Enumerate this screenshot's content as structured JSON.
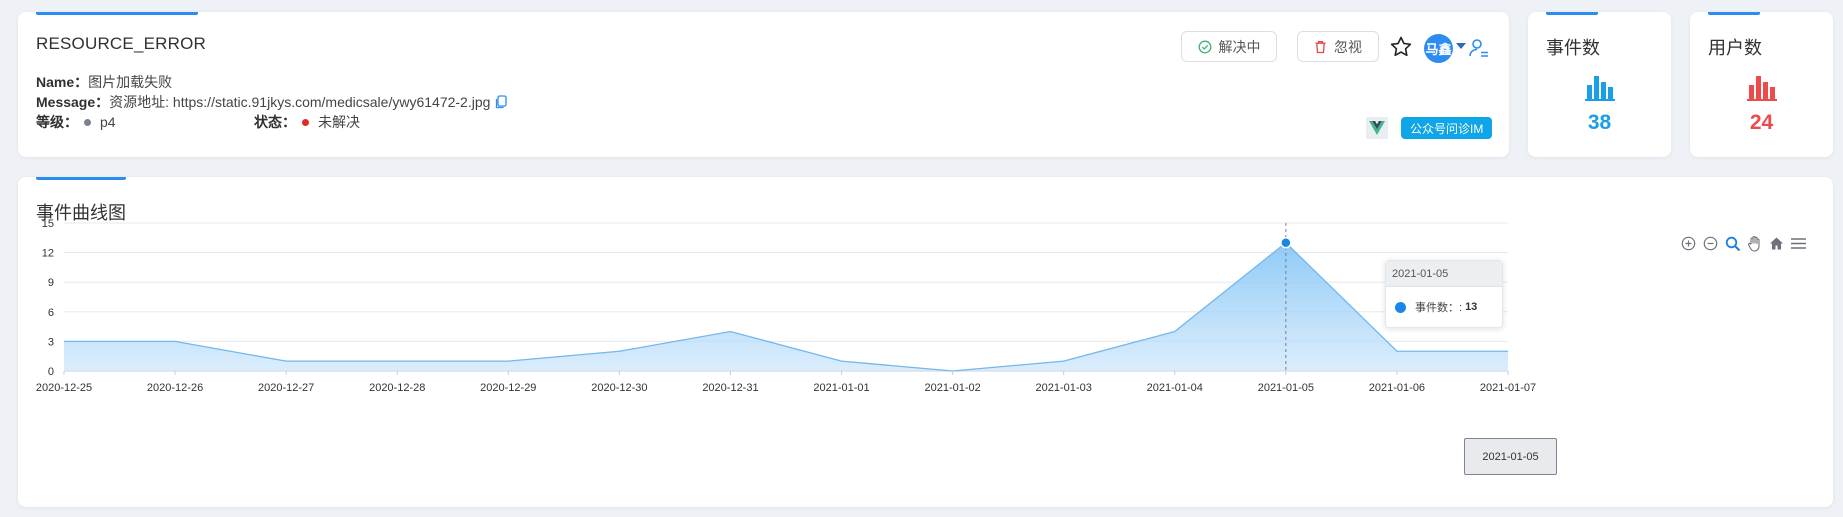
{
  "issue": {
    "type": "RESOURCE_ERROR",
    "name_label": "Name：",
    "name_value": "图片加载失败",
    "message_label": "Message：",
    "message_value": "资源地址: https://static.91jkys.com/medicsale/ywy61472-2.jpg",
    "level_label": "等级：",
    "level_value": "p4",
    "status_label": "状态：",
    "status_value": "未解决",
    "level_color": "#7a8291",
    "status_color": "#e32929"
  },
  "actions": {
    "resolve_label": "解决中",
    "ignore_label": "忽视",
    "assignee_initials": "马鑫"
  },
  "project": {
    "framework_icon": "vue-icon",
    "tag": "公众号问诊IM"
  },
  "stats": {
    "events": {
      "label": "事件数",
      "value": "38",
      "color": "#1a9ee8"
    },
    "users": {
      "label": "用户数",
      "value": "24",
      "color": "#ee4a4a"
    }
  },
  "chart_panel": {
    "title": "事件曲线图",
    "toolbar_icons": [
      "zoom-in-icon",
      "zoom-out-icon",
      "selection-zoom-icon",
      "pan-icon",
      "reset-home-icon",
      "menu-icon"
    ]
  },
  "chart_data": {
    "type": "area",
    "x": [
      "2020-12-25",
      "2020-12-26",
      "2020-12-27",
      "2020-12-28",
      "2020-12-29",
      "2020-12-30",
      "2020-12-31",
      "2021-01-01",
      "2021-01-02",
      "2021-01-03",
      "2021-01-04",
      "2021-01-05",
      "2021-01-06",
      "2021-01-07"
    ],
    "series": [
      {
        "values": [
          3,
          3,
          1,
          1,
          1,
          2,
          4,
          1,
          0,
          1,
          4,
          13,
          2,
          2
        ],
        "color": "#73b7ec"
      }
    ],
    "ylim": [
      0,
      15
    ],
    "yticks": [
      0,
      3,
      6,
      9,
      12,
      15
    ],
    "grid": true,
    "tooltip": {
      "date": "2021-01-05",
      "label": "事件数：:",
      "value": "13",
      "dot_color": "#1a86e6"
    },
    "crosshair_label": "2021-01-05"
  }
}
